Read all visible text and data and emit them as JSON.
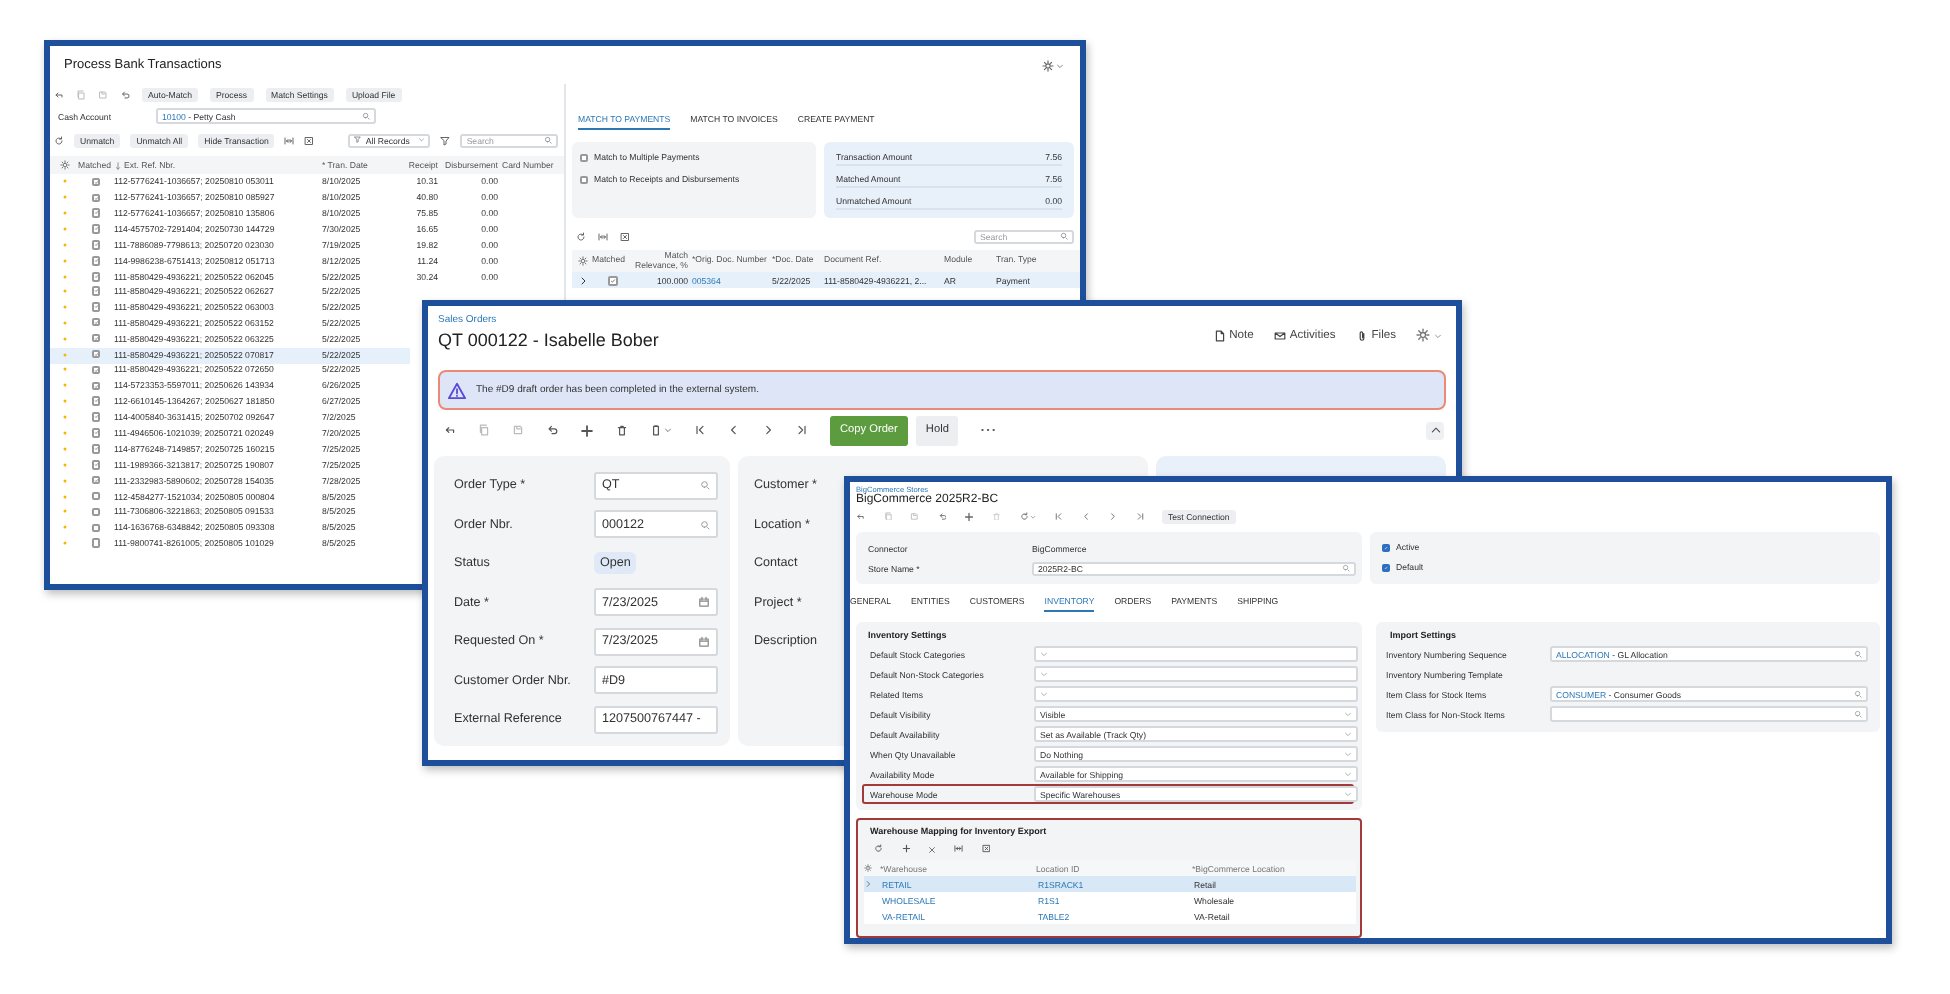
{
  "bank_window": {
    "title": "Process Bank Transactions",
    "toolbar_buttons": [
      "Auto-Match",
      "Process",
      "Match Settings",
      "Upload File"
    ],
    "cash_account": {
      "label": "Cash Account",
      "code": "10100",
      "name": "- Petty Cash"
    },
    "grid_buttons": [
      "Unmatch",
      "Unmatch All",
      "Hide Transaction"
    ],
    "filter": "All Records",
    "search_placeholder": "Search",
    "table": {
      "columns": [
        "Matched",
        "Ext. Ref. Nbr.",
        "* Tran. Date",
        "Receipt",
        "Disbursement",
        "Card Number"
      ],
      "rows": [
        {
          "matched": true,
          "selected": false,
          "ext_ref": "112-5776241-1036657; 20250810 053011",
          "tran_date": "8/10/2025",
          "receipt": "10.31",
          "disbursement": "0.00"
        },
        {
          "matched": true,
          "selected": false,
          "ext_ref": "112-5776241-1036657; 20250810 085927",
          "tran_date": "8/10/2025",
          "receipt": "40.80",
          "disbursement": "0.00"
        },
        {
          "matched": true,
          "selected": false,
          "ext_ref": "112-5776241-1036657; 20250810 135806",
          "tran_date": "8/10/2025",
          "receipt": "75.85",
          "disbursement": "0.00"
        },
        {
          "matched": true,
          "selected": false,
          "ext_ref": "114-4575702-7291404; 20250730 144729",
          "tran_date": "7/30/2025",
          "receipt": "16.65",
          "disbursement": "0.00"
        },
        {
          "matched": true,
          "selected": false,
          "ext_ref": "111-7886089-7798613; 20250720 023030",
          "tran_date": "7/19/2025",
          "receipt": "19.82",
          "disbursement": "0.00"
        },
        {
          "matched": true,
          "selected": false,
          "ext_ref": "114-9986238-6751413; 20250812 051713",
          "tran_date": "8/12/2025",
          "receipt": "11.24",
          "disbursement": "0.00"
        },
        {
          "matched": true,
          "selected": false,
          "ext_ref": "111-8580429-4936221; 20250522 062045",
          "tran_date": "5/22/2025",
          "receipt": "30.24",
          "disbursement": "0.00"
        },
        {
          "matched": true,
          "selected": false,
          "ext_ref": "111-8580429-4936221; 20250522 062627",
          "tran_date": "5/22/2025"
        },
        {
          "matched": true,
          "selected": false,
          "ext_ref": "111-8580429-4936221; 20250522 063003",
          "tran_date": "5/22/2025"
        },
        {
          "matched": true,
          "selected": false,
          "ext_ref": "111-8580429-4936221; 20250522 063152",
          "tran_date": "5/22/2025"
        },
        {
          "matched": true,
          "selected": false,
          "ext_ref": "111-8580429-4936221; 20250522 063225",
          "tran_date": "5/22/2025"
        },
        {
          "matched": true,
          "selected": true,
          "ext_ref": "111-8580429-4936221; 20250522 070817",
          "tran_date": "5/22/2025"
        },
        {
          "matched": true,
          "selected": false,
          "ext_ref": "111-8580429-4936221; 20250522 072650",
          "tran_date": "5/22/2025"
        },
        {
          "matched": true,
          "selected": false,
          "ext_ref": "114-5723353-5597011; 20250626 143934",
          "tran_date": "6/26/2025"
        },
        {
          "matched": true,
          "selected": false,
          "ext_ref": "112-6610145-1364267; 20250627 181850",
          "tran_date": "6/27/2025"
        },
        {
          "matched": true,
          "selected": false,
          "ext_ref": "114-4005840-3631415; 20250702 092647",
          "tran_date": "7/2/2025"
        },
        {
          "matched": true,
          "selected": false,
          "ext_ref": "111-4946506-1021039; 20250721 020249",
          "tran_date": "7/20/2025"
        },
        {
          "matched": true,
          "selected": false,
          "ext_ref": "114-8776248-7149857; 20250725 160215",
          "tran_date": "7/25/2025"
        },
        {
          "matched": true,
          "selected": false,
          "ext_ref": "111-1989366-3213817; 20250725 190807",
          "tran_date": "7/25/2025"
        },
        {
          "matched": true,
          "selected": false,
          "ext_ref": "111-2332983-5890602; 20250728 154035",
          "tran_date": "7/28/2025"
        },
        {
          "matched": false,
          "selected": false,
          "ext_ref": "112-4584277-1521034; 20250805 000804",
          "tran_date": "8/5/2025"
        },
        {
          "matched": false,
          "selected": false,
          "ext_ref": "111-7306806-3221863; 20250805 091533",
          "tran_date": "8/5/2025"
        },
        {
          "matched": false,
          "selected": false,
          "ext_ref": "114-1636768-6348842; 20250805 093308",
          "tran_date": "8/5/2025"
        },
        {
          "matched": false,
          "selected": false,
          "ext_ref": "111-9800741-8261005; 20250805 101029",
          "tran_date": "8/5/2025"
        }
      ]
    },
    "tabs": [
      {
        "label": "MATCH TO PAYMENTS",
        "selected": true
      },
      {
        "label": "MATCH TO INVOICES",
        "selected": false
      },
      {
        "label": "CREATE PAYMENT",
        "selected": false
      }
    ],
    "options": [
      {
        "label": "Match to Multiple Payments",
        "checked": false
      },
      {
        "label": "Match to Receipts and Disbursements",
        "checked": false
      }
    ],
    "amounts": [
      {
        "label": "Transaction Amount",
        "value": "7.56"
      },
      {
        "label": "Matched Amount",
        "value": "7.56"
      },
      {
        "label": "Unmatched Amount",
        "value": "0.00"
      }
    ],
    "match_search_placeholder": "Search",
    "match_table": {
      "columns": [
        "Matched",
        "Match Relevance, %",
        "*Orig. Doc. Number",
        "*Doc. Date",
        "Document Ref.",
        "Module",
        "Tran. Type"
      ],
      "rows": [
        {
          "matched": true,
          "relevance": "100.000",
          "doc_number": "005364",
          "doc_date": "5/22/2025",
          "doc_ref": "111-8580429-4936221, 2...",
          "module": "AR",
          "tran_type": "Payment"
        }
      ]
    }
  },
  "order_window": {
    "breadcrumb": "Sales Orders",
    "title": "QT 000122 - Isabelle Bober",
    "header_actions": [
      {
        "kind": "note",
        "label": "Note"
      },
      {
        "kind": "activities",
        "label": "Activities"
      },
      {
        "kind": "files",
        "label": "Files"
      }
    ],
    "alert": "The #D9 draft order has been completed in the external system.",
    "toolbar_buttons": [
      {
        "label": "Copy Order",
        "primary": true
      },
      {
        "label": "Hold",
        "primary": false
      }
    ],
    "fields": [
      {
        "label": "Order Type *",
        "value": "QT",
        "kind": "lookup"
      },
      {
        "label": "Order Nbr.",
        "value": "000122",
        "kind": "lookup"
      },
      {
        "label": "Status",
        "value": "Open",
        "kind": "status"
      },
      {
        "label": "Date *",
        "value": "7/23/2025",
        "kind": "date"
      },
      {
        "label": "Requested On *",
        "value": "7/23/2025",
        "kind": "date"
      },
      {
        "label": "Customer Order Nbr.",
        "value": "#D9",
        "kind": "text"
      },
      {
        "label": "External Reference",
        "value": "1207500767447 -",
        "kind": "text"
      }
    ],
    "right_labels": [
      "Customer *",
      "Location *",
      "Contact",
      "Project *",
      "Description"
    ]
  },
  "store_window": {
    "breadcrumb": "BigCommerce Stores",
    "title": "BigCommerce 2025R2-BC",
    "toolbar_button": "Test Connection",
    "summary": [
      {
        "label": "Connector",
        "value": "BigCommerce",
        "kind": "text"
      },
      {
        "label": "Store Name *",
        "value": "2025R2-BC",
        "kind": "lookup"
      }
    ],
    "flags": [
      {
        "label": "Active",
        "checked": true
      },
      {
        "label": "Default",
        "checked": true
      }
    ],
    "tabs": [
      {
        "label": "GENERAL",
        "selected": false
      },
      {
        "label": "ENTITIES",
        "selected": false
      },
      {
        "label": "CUSTOMERS",
        "selected": false
      },
      {
        "label": "INVENTORY",
        "selected": true
      },
      {
        "label": "ORDERS",
        "selected": false
      },
      {
        "label": "PAYMENTS",
        "selected": false
      },
      {
        "label": "SHIPPING",
        "selected": false
      }
    ],
    "inventory": {
      "title": "Inventory Settings",
      "fields": [
        {
          "label": "Default Stock Categories",
          "highlighted": false
        },
        {
          "label": "Default Non-Stock Categories",
          "highlighted": false
        },
        {
          "label": "Related Items",
          "highlighted": false
        },
        {
          "label": "Default Visibility",
          "value": "Visible",
          "highlighted": false
        },
        {
          "label": "Default Availability",
          "value": "Set as Available (Track Qty)",
          "highlighted": false
        },
        {
          "label": "When Qty Unavailable",
          "value": "Do Nothing",
          "highlighted": false
        },
        {
          "label": "Availability Mode",
          "value": "Available for Shipping",
          "highlighted": false
        },
        {
          "label": "Warehouse Mode",
          "value": "Specific Warehouses",
          "highlighted": true
        }
      ]
    },
    "import": {
      "title": "Import Settings",
      "fields": [
        {
          "label": "Inventory Numbering Sequence",
          "kind": "lookup",
          "code": "ALLOCATION",
          "name": "- GL Allocation"
        },
        {
          "label": "Inventory Numbering Template",
          "kind": "none"
        },
        {
          "label": "Item Class for Stock Items",
          "kind": "lookup",
          "code": "CONSUMER",
          "name": "- Consumer Goods"
        },
        {
          "label": "Item Class for Non-Stock Items",
          "kind": "lookup"
        }
      ]
    },
    "mapping": {
      "title": "Warehouse Mapping for Inventory Export",
      "highlighted": true,
      "columns": [
        "*Warehouse",
        "Location ID",
        "*BigCommerce Location"
      ],
      "rows": [
        {
          "warehouse": "RETAIL",
          "location": "R1SRACK1",
          "bc_location": "Retail",
          "selected": true
        },
        {
          "warehouse": "WHOLESALE",
          "location": "R1S1",
          "bc_location": "Wholesale",
          "selected": false
        },
        {
          "warehouse": "VA-RETAIL",
          "location": "TABLE2",
          "bc_location": "VA-Retail",
          "selected": false
        }
      ]
    }
  }
}
